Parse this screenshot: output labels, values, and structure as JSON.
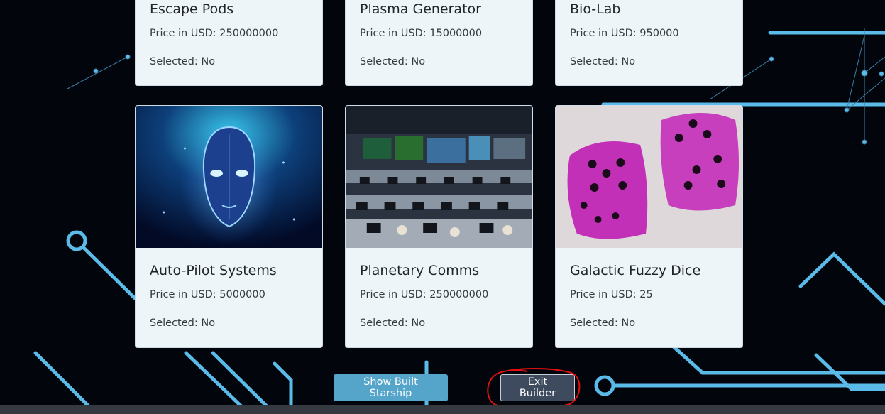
{
  "products": {
    "row1": [
      {
        "title": "Escape Pods",
        "price": "Price in USD: 250000000",
        "selected": "Selected: No"
      },
      {
        "title": "Plasma Generator",
        "price": "Price in USD: 15000000",
        "selected": "Selected: No"
      },
      {
        "title": "Bio-Lab",
        "price": "Price in USD: 950000",
        "selected": "Selected: No"
      }
    ],
    "row2": [
      {
        "title": "Auto-Pilot Systems",
        "price": "Price in USD: 5000000",
        "selected": "Selected: No",
        "image": "ai-robot-head-image"
      },
      {
        "title": "Planetary Comms",
        "price": "Price in USD: 250000000",
        "selected": "Selected: No",
        "image": "mission-control-room-image"
      },
      {
        "title": "Galactic Fuzzy Dice",
        "price": "Price in USD: 25",
        "selected": "Selected: No",
        "image": "pink-fuzzy-dice-image"
      }
    ]
  },
  "actions": {
    "show_built_label": "Show Built Starship",
    "exit_label": "Exit Builder"
  },
  "colors": {
    "background": "#03050c",
    "circuit": "#5bbbe8",
    "card": "#eef5f9",
    "show_button": "#55a4c9",
    "exit_button": "#3e4a5e",
    "annotation": "#e01010"
  }
}
